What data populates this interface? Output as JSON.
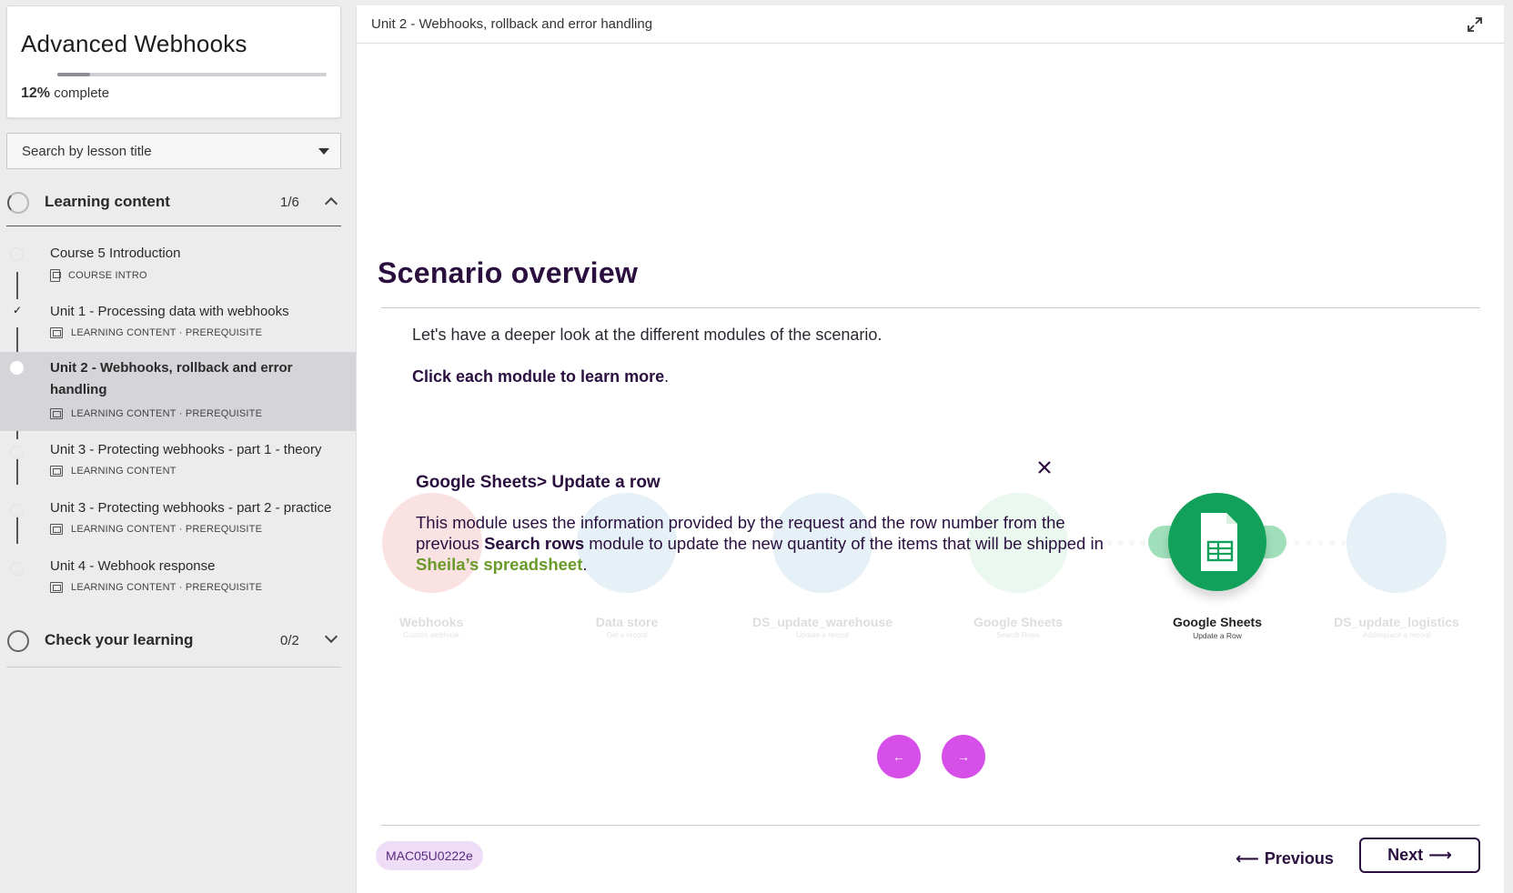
{
  "sidebar": {
    "course_title": "Advanced Webhooks",
    "progress_percent": 12,
    "progress_value": "12%",
    "progress_suffix": "complete",
    "search_placeholder": "Search by lesson title",
    "sections": [
      {
        "title": "Learning content",
        "count": "1/6",
        "expanded": true,
        "lessons": [
          {
            "name": "Course 5 Introduction",
            "meta": "COURSE INTRO",
            "completed": false,
            "active": false
          },
          {
            "name": "Unit 1 - Processing data with webhooks",
            "meta": "LEARNING CONTENT · PREREQUISITE",
            "completed": true,
            "active": false
          },
          {
            "name": "Unit 2 - Webhooks, rollback and error handling",
            "meta": "LEARNING CONTENT · PREREQUISITE",
            "completed": false,
            "active": true
          },
          {
            "name": "Unit 3 - Protecting webhooks - part 1 - theory",
            "meta": "LEARNING CONTENT",
            "completed": false,
            "active": false
          },
          {
            "name": "Unit 3 - Protecting webhooks - part 2 - practice",
            "meta": "LEARNING CONTENT · PREREQUISITE",
            "completed": false,
            "active": false
          },
          {
            "name": "Unit 4 - Webhook response",
            "meta": "LEARNING CONTENT · PREREQUISITE",
            "completed": false,
            "active": false
          }
        ]
      },
      {
        "title": "Check your learning",
        "count": "0/2",
        "expanded": false
      }
    ]
  },
  "main": {
    "breadcrumb": "Unit 2 - Webhooks, rollback and error handling",
    "heading": "Scenario overview",
    "intro": "Let's have a deeper look at the different modules of the scenario.",
    "click_bold": "Click each module to learn more",
    "click_tail": ".",
    "popup": {
      "title": "Google Sheets> Update a row",
      "body_1": "This module uses the information provided by the request and the row number from the previous ",
      "body_bold": "Search rows",
      "body_2": " module to update the new quantity of the items that will be shipped in ",
      "body_link": "Sheila’s spreadsheet",
      "body_3": "."
    },
    "modules": [
      {
        "name": "Webhooks",
        "sub": "Custom webhook",
        "color": "#e0454b"
      },
      {
        "name": "Data store",
        "sub": "Get a record",
        "color": "#5fa7c9"
      },
      {
        "name": "DS_update_warehouse",
        "sub": "Update a record",
        "color": "#5fa7c9"
      },
      {
        "name": "Google Sheets",
        "sub": "Search Rows",
        "color": "#12a15a"
      },
      {
        "name": "Google Sheets",
        "sub": "Update a Row",
        "color": "#12a15a"
      },
      {
        "name": "DS_update_logistics",
        "sub": "Add/replace a record",
        "color": "#5fa7c9"
      }
    ],
    "lesson_code": "MAC05U0222e",
    "previous_label": "Previous",
    "next_label": "Next"
  },
  "colors": {
    "accent_purple": "#2a0f3f",
    "nav_pink": "#d74fe9",
    "sheets_green": "#12a15a",
    "highlight_green": "#6a9a2a"
  }
}
